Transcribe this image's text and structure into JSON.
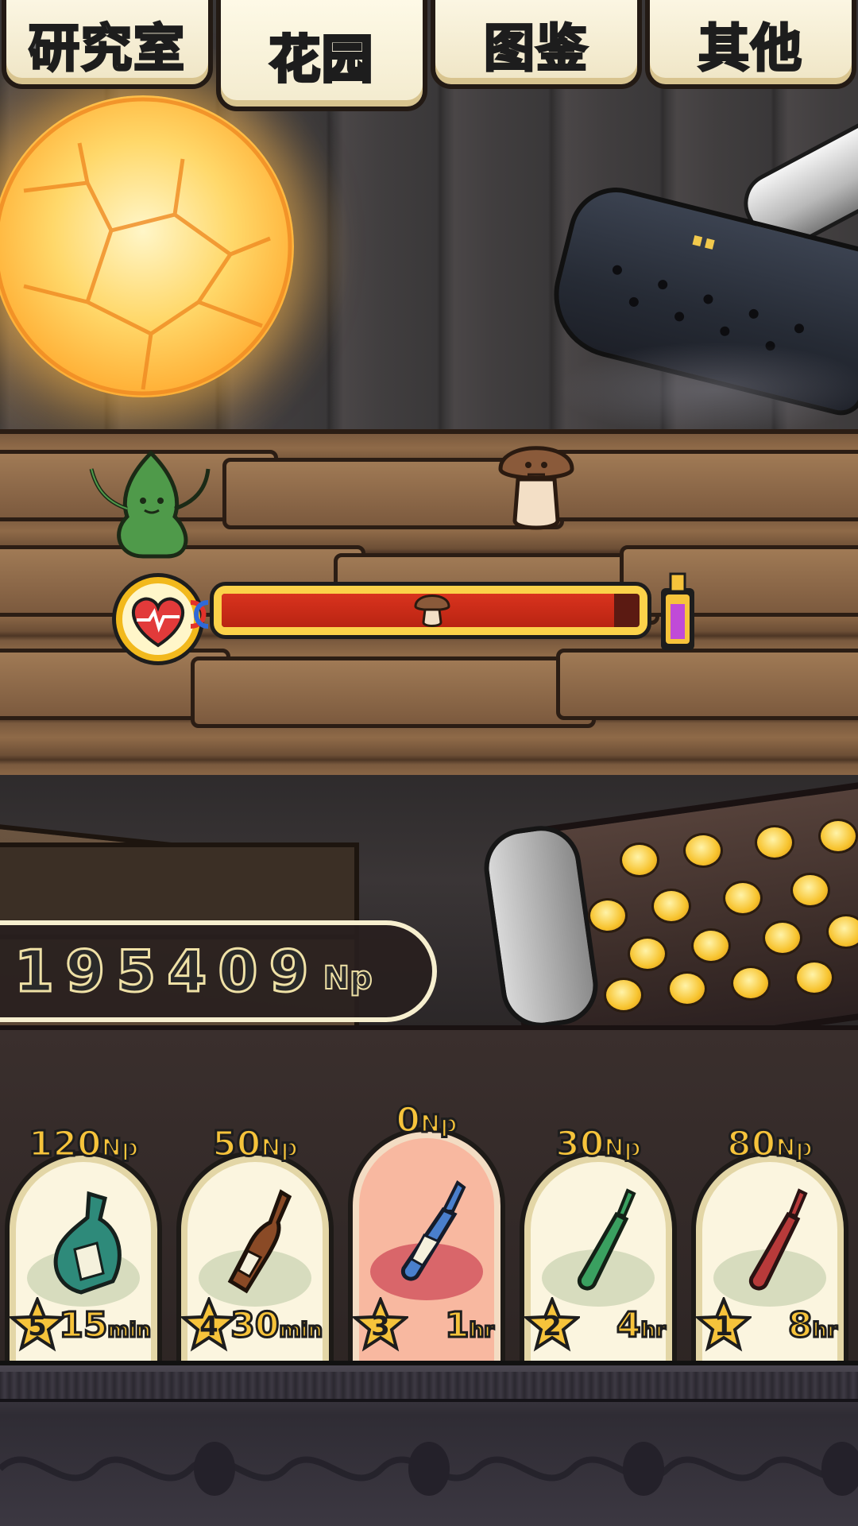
{
  "tabs": [
    {
      "label": "研究室",
      "active": false
    },
    {
      "label": "花园",
      "active": true
    },
    {
      "label": "图鉴",
      "active": false
    },
    {
      "label": "其他",
      "active": false
    }
  ],
  "health_bar": {
    "icon": "heart-icon",
    "fill_fraction": 0.94,
    "marker_icon": "mushroom-icon",
    "end_icon": "potion-vial-icon"
  },
  "money": {
    "value": "195409",
    "unit": "Np"
  },
  "items": [
    {
      "price": "120",
      "price_unit": "Np",
      "stars": "5",
      "time": "15",
      "time_unit": "min",
      "bottle": "teal-flask",
      "color": "#2e8a7a",
      "selected": false
    },
    {
      "price": "50",
      "price_unit": "Np",
      "stars": "4",
      "time": "30",
      "time_unit": "min",
      "bottle": "brown-bottle",
      "color": "#8a4a26",
      "selected": false
    },
    {
      "price": "0",
      "price_unit": "Np",
      "stars": "3",
      "time": "1",
      "time_unit": "hr",
      "bottle": "blue-ampoule",
      "color": "#4a7fcc",
      "selected": true
    },
    {
      "price": "30",
      "price_unit": "Np",
      "stars": "2",
      "time": "4",
      "time_unit": "hr",
      "bottle": "green-ampoule",
      "color": "#3aa060",
      "selected": false
    },
    {
      "price": "80",
      "price_unit": "Np",
      "stars": "1",
      "time": "8",
      "time_unit": "hr",
      "bottle": "red-ampoule",
      "color": "#b83a3a",
      "selected": false
    }
  ],
  "colors": {
    "tab_active_text": "#f8c73a",
    "tab_text": "#6b6b6b",
    "bar_fill": "#c92a16",
    "gold": "#f6c33b"
  }
}
